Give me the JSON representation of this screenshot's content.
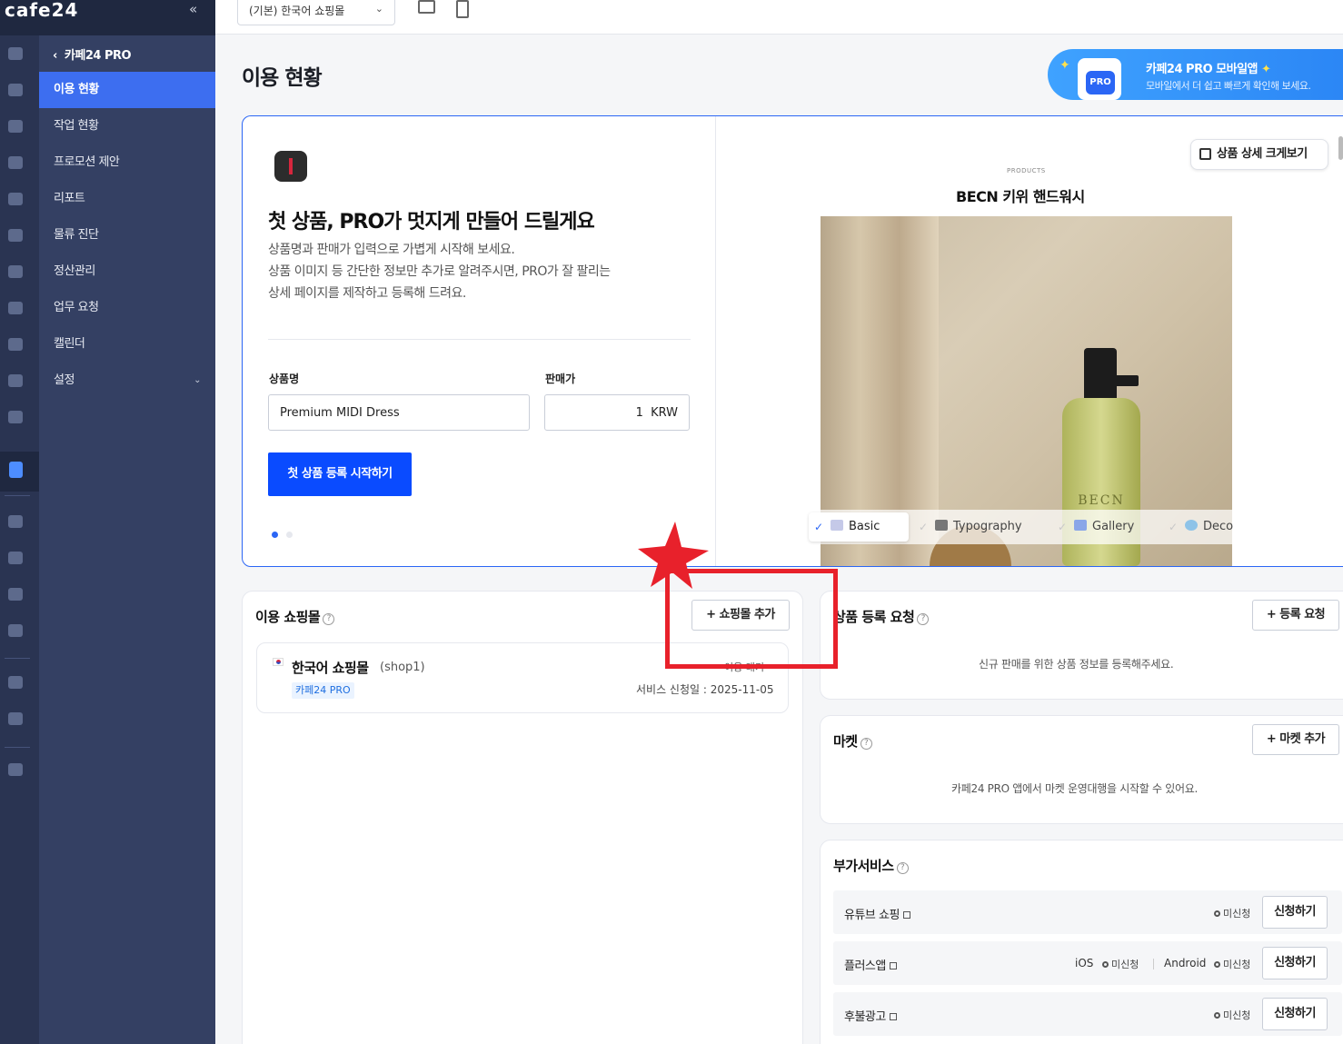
{
  "brand": {
    "logo": "cafe24",
    "collapse_icon": "«"
  },
  "colors": {
    "accent": "#3d6ef0",
    "primary_button": "#0a4bff",
    "sidebar_dark": "#2a3452",
    "sidebar": "#344063",
    "annotation_red": "#e8212b"
  },
  "submenu": {
    "title": "카페24 PRO",
    "items": [
      {
        "label": "이용 현황",
        "active": true
      },
      {
        "label": "작업 현황"
      },
      {
        "label": "프로모션 제안"
      },
      {
        "label": "리포트"
      },
      {
        "label": "물류 진단"
      },
      {
        "label": "정산관리"
      },
      {
        "label": "업무 요청"
      },
      {
        "label": "캘린더"
      },
      {
        "label": "설정",
        "chevron": "⌄"
      }
    ]
  },
  "topbar": {
    "shop_select": "(기본) 한국어 쇼핑몰",
    "icons": [
      "desktop-icon",
      "mobile-icon"
    ]
  },
  "page": {
    "title": "이용 현황"
  },
  "promo": {
    "title": "카페24 PRO 모바일앱",
    "subtitle": "모바일에서 더 쉽고 빠르게 확인해 보세요.",
    "badge": "PRO",
    "sparkle": "✦"
  },
  "hero": {
    "title": "첫 상품, PRO가 멋지게 만들어 드릴게요",
    "description": "상품명과 판매가 입력으로 가볍게 시작해 보세요.\n상품 이미지 등 간단한 정보만 추가로 알려주시면, PRO가 잘 팔리는\n상세 페이지를 제작하고 등록해 드려요.",
    "name_label": "상품명",
    "name_value": "Premium MIDI Dress",
    "price_label": "판매가",
    "price_value": "1  KRW",
    "start_button": "첫 상품 등록 시작하기",
    "preview_button": "상품 상세 크게보기",
    "products_tag": "PRODUCTS",
    "product_title": "BECN 키위 핸드워시",
    "bottle_text": "BECN",
    "tabs": [
      {
        "label": "Basic",
        "active": true
      },
      {
        "label": "Typography"
      },
      {
        "label": "Gallery"
      },
      {
        "label": "Deco"
      }
    ],
    "check": "✓"
  },
  "shops_card": {
    "title": "이용 쇼핑몰",
    "add_button": "+ 쇼핑몰 추가",
    "shop": {
      "name": "한국어 쇼핑몰",
      "id": "(shop1)",
      "badge": "카페24 PRO",
      "status": "이용 대기",
      "date": "서비스 신청일 : 2025-11-05"
    }
  },
  "product_request_card": {
    "title": "상품 등록 요청",
    "button": "+ 등록 요청",
    "message": "신규 판매를 위한 상품 정보를 등록해주세요."
  },
  "market_card": {
    "title": "마켓",
    "button": "+ 마켓 추가",
    "message": "카페24 PRO 앱에서 마켓 운영대행을 시작할 수 있어요."
  },
  "addon_card": {
    "title": "부가서비스",
    "help": "?",
    "services": [
      {
        "name": "유튜브 쇼핑",
        "status": "미신청",
        "button": "신청하기"
      },
      {
        "name": "플러스앱",
        "ios_label": "iOS",
        "ios_status": "미신청",
        "android_label": "Android",
        "android_status": "미신청",
        "button": "신청하기"
      },
      {
        "name": "후불광고",
        "status": "미신청",
        "button": "신청하기"
      }
    ]
  }
}
